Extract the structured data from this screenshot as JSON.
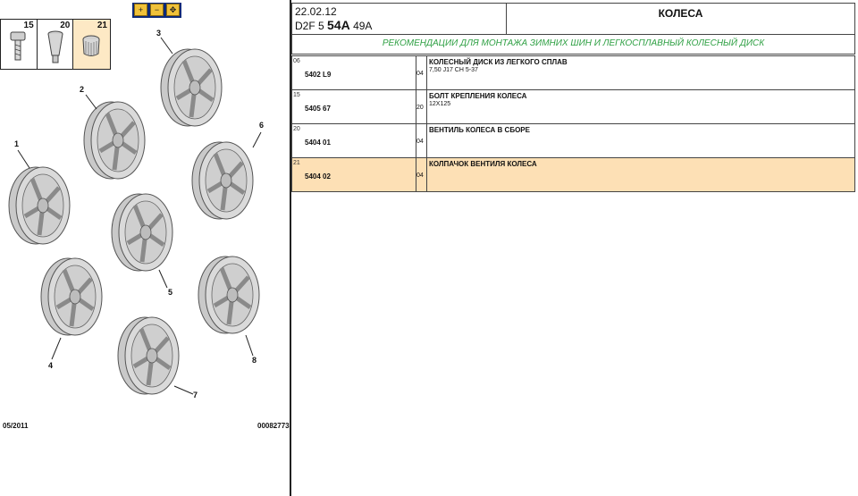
{
  "toolbar": {
    "buttons": [
      {
        "name": "zoom-in",
        "glyph": "+"
      },
      {
        "name": "zoom-out",
        "glyph": "−"
      },
      {
        "name": "zoom-fit",
        "glyph": "✥"
      }
    ]
  },
  "diagram": {
    "inset": [
      {
        "num": "15",
        "icon": "bolt-icon"
      },
      {
        "num": "20",
        "icon": "valve-icon"
      },
      {
        "num": "21",
        "icon": "valve-cap-icon",
        "highlight": true
      }
    ],
    "callouts": [
      "1",
      "2",
      "3",
      "4",
      "5",
      "6",
      "7",
      "8"
    ],
    "footer_date": "05/2011",
    "footer_code": "00082773"
  },
  "header": {
    "date": "22.02.12",
    "ref_prefix": "D2F 5",
    "ref_bold": "54A",
    "ref_suffix": "49A",
    "title": "КОЛЕСА"
  },
  "recommendation": "РЕКОМЕНДАЦИИ ДЛЯ МОНТАЖА ЗИМНИХ ШИН И ЛЕГКОСПЛАВНЫЙ КОЛЕСНЫЙ ДИСК",
  "parts": [
    {
      "index": "06",
      "part_no": "5402 L9",
      "qty": "04",
      "name": "КОЛЕСНЫЙ ДИСК ИЗ ЛЕГКОГО СПЛАВ",
      "spec": "7,50 J17 CH 5-37",
      "selected": false
    },
    {
      "index": "15",
      "part_no": "5405 67",
      "qty": "20",
      "name": "БОЛТ КРЕПЛЕНИЯ КОЛЕСА",
      "spec": "12X125",
      "selected": false
    },
    {
      "index": "20",
      "part_no": "5404 01",
      "qty": "04",
      "name": "ВЕНТИЛЬ КОЛЕСА В СБОРЕ",
      "spec": "",
      "selected": false
    },
    {
      "index": "21",
      "part_no": "5404 02",
      "qty": "04",
      "name": "КОЛПАЧОК ВЕНТИЛЯ КОЛЕСА",
      "spec": "",
      "selected": true
    }
  ],
  "colors": {
    "toolbar_bg": "#0d2a78",
    "zoom_btn": "#f0c23a",
    "selected_row": "#fde0b5",
    "recommend_text": "#2ea043",
    "wheel_fill": "#d2d2d2",
    "wheel_stroke": "#555555"
  }
}
